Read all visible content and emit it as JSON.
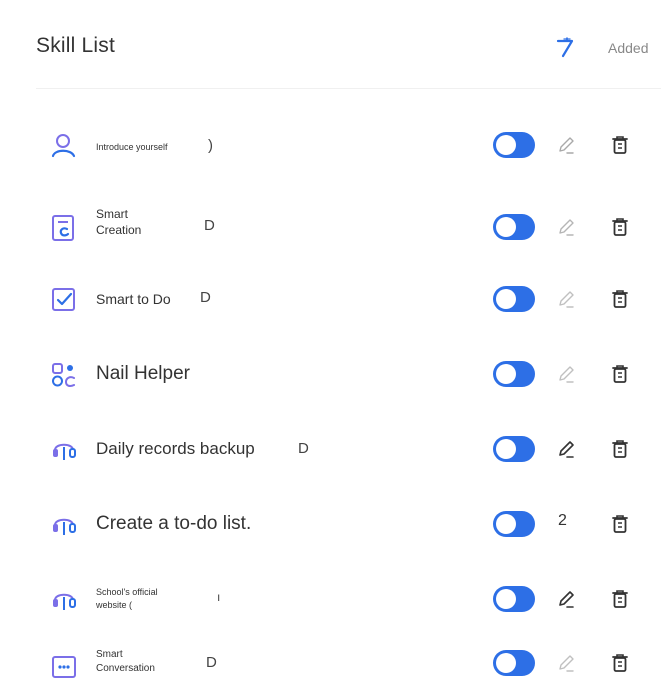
{
  "header": {
    "title": "Skill List",
    "action_icon": "magic-wand-icon",
    "added_label": "Added"
  },
  "colors": {
    "accent": "#2d6fe6",
    "icon_purple": "#7b6fe8",
    "text": "#333333",
    "muted": "#9a9a9a"
  },
  "skills": [
    {
      "label": "Introduce yourself",
      "marker": ")",
      "icon": "person-icon",
      "enabled": true,
      "edit_icon": "pencil-icon"
    },
    {
      "label": "Smart Creation",
      "line1": "Smart",
      "line2": "Creation",
      "marker": "D",
      "icon": "document-c-icon",
      "enabled": true,
      "edit_icon": "pencil-icon"
    },
    {
      "label": "Smart to Do",
      "marker": "D",
      "icon": "checkbox-icon",
      "enabled": true,
      "edit_icon": "pencil-icon"
    },
    {
      "label": "Nail Helper",
      "marker": "",
      "icon": "grid-apps-icon",
      "enabled": true,
      "edit_icon": "pencil-icon"
    },
    {
      "label": "Daily records backup",
      "marker": "D",
      "icon": "robot-headset-icon",
      "enabled": true,
      "edit_icon": "pencil-icon"
    },
    {
      "label": "Create a to-do list.",
      "marker": "",
      "icon": "robot-headset-icon",
      "enabled": true,
      "edit_text": "2"
    },
    {
      "label": "School's official website (",
      "line1": "School's official",
      "line2": "website (",
      "marker": "ı",
      "icon": "robot-headset-icon",
      "enabled": true,
      "edit_icon": "pencil-icon"
    },
    {
      "label": "Smart Conversation",
      "line1": "Smart",
      "line2": "Conversation",
      "marker": "D",
      "icon": "chat-bubble-icon",
      "enabled": true,
      "edit_icon": "pencil-icon"
    }
  ]
}
